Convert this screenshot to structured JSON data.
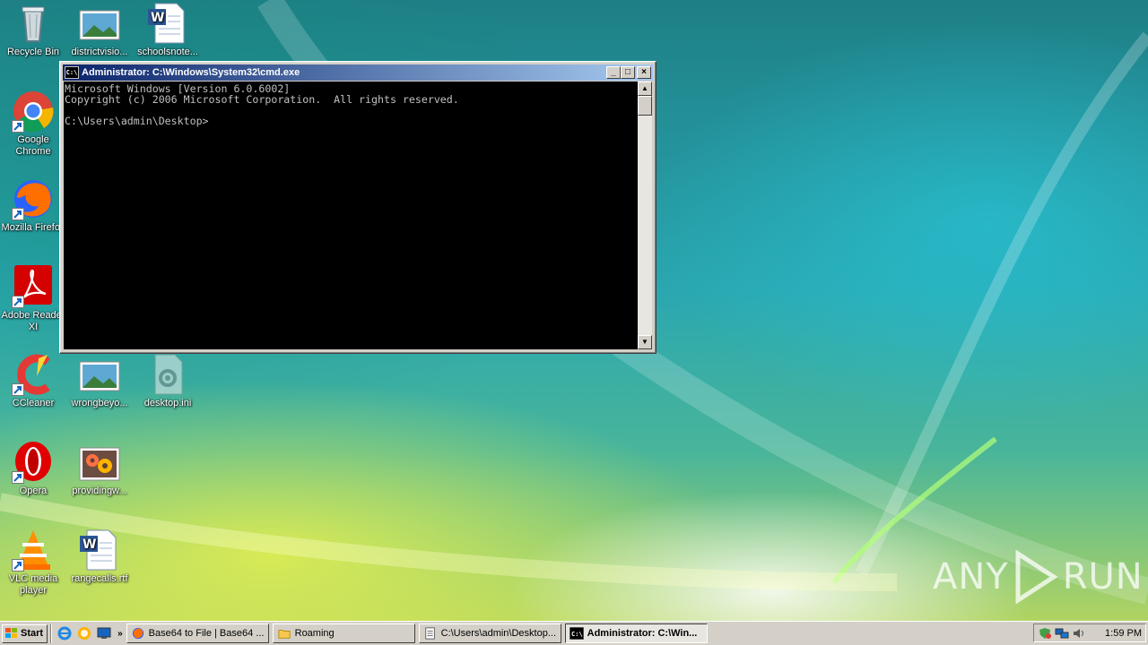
{
  "desktop_icons": [
    {
      "name": "recycle-bin",
      "label": "Recycle Bin"
    },
    {
      "name": "districtvision",
      "label": "districtvisio..."
    },
    {
      "name": "schoolsnote",
      "label": "schoolsnote..."
    },
    {
      "name": "google-chrome",
      "label": "Google Chrome"
    },
    {
      "name": "mozilla-firefox",
      "label": "Mozilla Firefox"
    },
    {
      "name": "adobe-reader",
      "label": "Adobe Reader XI"
    },
    {
      "name": "ccleaner",
      "label": "CCleaner"
    },
    {
      "name": "wrongbeyond",
      "label": "wrongbeyo..."
    },
    {
      "name": "desktop-ini",
      "label": "desktop.ini"
    },
    {
      "name": "opera",
      "label": "Opera"
    },
    {
      "name": "providingw",
      "label": "providingw..."
    },
    {
      "name": "vlc",
      "label": "VLC media player"
    },
    {
      "name": "rangecalls",
      "label": "rangecalls.rtf"
    }
  ],
  "cmd_window": {
    "title": "Administrator: C:\\Windows\\System32\\cmd.exe",
    "icon_text": "C:\\",
    "lines": [
      "Microsoft Windows [Version 6.0.6002]",
      "Copyright (c) 2006 Microsoft Corporation.  All rights reserved.",
      "",
      "C:\\Users\\admin\\Desktop>"
    ],
    "buttons": {
      "minimize": "_",
      "maximize": "□",
      "close": "×"
    }
  },
  "taskbar": {
    "start_label": "Start",
    "quicklaunch_more": "»",
    "tasks": [
      {
        "icon": "firefox-icon",
        "label": "Base64 to File | Base64 ...",
        "active": false
      },
      {
        "icon": "folder-icon",
        "label": "Roaming",
        "active": false
      },
      {
        "icon": "notepad-icon",
        "label": "C:\\Users\\admin\\Desktop...",
        "active": false
      },
      {
        "icon": "cmd-icon",
        "label": "Administrator: C:\\Win...",
        "active": true
      }
    ],
    "clock": "1:59 PM"
  },
  "watermark": {
    "left": "ANY",
    "right": "RUN"
  },
  "colors": {
    "titlebar_start": "#0a246a",
    "titlebar_end": "#a6caf0",
    "console_bg": "#000000",
    "console_fg": "#c0c0c0",
    "taskbar": "#d4d0c8"
  }
}
